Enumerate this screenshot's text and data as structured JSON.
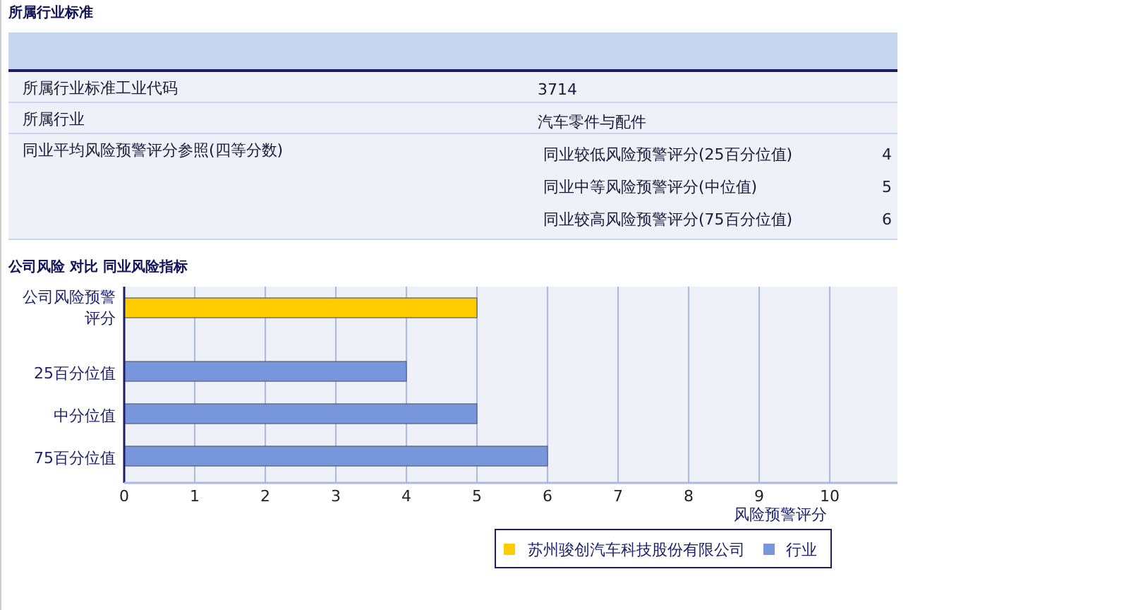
{
  "industry_section": {
    "title": "所属行业标准",
    "rows": [
      {
        "label": "所属行业标准工业代码",
        "value": "3714"
      },
      {
        "label": "所属行业",
        "value": "汽车零件与配件"
      }
    ],
    "reference": {
      "label": "同业平均风险预警评分参照(四等分数)",
      "items": [
        {
          "label": "同业较低风险预警评分(25百分位值)",
          "value": "4"
        },
        {
          "label": "同业中等风险预警评分(中位值)",
          "value": "5"
        },
        {
          "label": "同业较高风险预警评分(75百分位值)",
          "value": "6"
        }
      ]
    }
  },
  "chart_section": {
    "title": "公司风险 对比 同业风险指标",
    "chart_data": {
      "type": "bar",
      "orientation": "horizontal",
      "xlabel": "风险预警评分",
      "categories": [
        "公司风险预警评分",
        "25百分位值",
        "中分位值",
        "75百分位值"
      ],
      "series": [
        {
          "name": "苏州骏创汽车科技股份有限公司",
          "color": "#ffcc00",
          "values": [
            5,
            null,
            null,
            null
          ]
        },
        {
          "name": "行业",
          "color": "#7896dc",
          "values": [
            null,
            4,
            5,
            6
          ]
        }
      ],
      "xlim": [
        0,
        10.96
      ],
      "grid": "x",
      "legend": "bottom",
      "xticks": [
        0,
        1,
        2,
        3,
        4,
        5,
        6,
        7,
        8,
        9,
        10
      ]
    }
  }
}
